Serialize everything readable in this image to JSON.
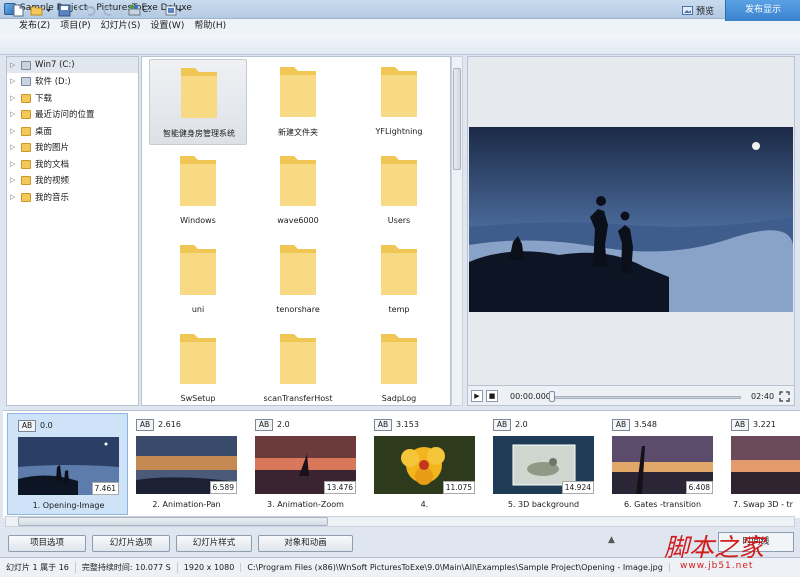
{
  "window": {
    "title": "Sample Project - PicturesToExe Deluxe",
    "controls": {
      "min": "–",
      "max": "□",
      "close": "✕"
    }
  },
  "menu": [
    "发布(Z)",
    "项目(P)",
    "幻灯片(S)",
    "设置(W)",
    "帮助(H)"
  ],
  "toolbar": {
    "drive": "C:",
    "preview": "预览",
    "publish": "发布显示"
  },
  "tree": [
    {
      "label": "Win7 (C:)",
      "icon": "drive-icon",
      "selected": true
    },
    {
      "label": "软件 (D:)",
      "icon": "drive-icon"
    },
    {
      "label": "下载",
      "icon": "folder-icon"
    },
    {
      "label": "最近访问的位置",
      "icon": "folder-icon"
    },
    {
      "label": "桌面",
      "icon": "folder-icon"
    },
    {
      "label": "我的图片",
      "icon": "folder-icon"
    },
    {
      "label": "我的文档",
      "icon": "folder-icon"
    },
    {
      "label": "我的视频",
      "icon": "folder-icon"
    },
    {
      "label": "我的音乐",
      "icon": "folder-icon"
    }
  ],
  "folders": [
    "智能健身房管理系统",
    "新建文件夹",
    "YFLightning",
    "Windows",
    "wave6000",
    "Users",
    "uni",
    "tenorshare",
    "temp",
    "SwSetup",
    "scanTransferHost",
    "SadpLog"
  ],
  "player": {
    "play": "▶",
    "stop": "■",
    "time_start": "00:00.000",
    "time_end": "02:40"
  },
  "slides": [
    {
      "ab": "AB",
      "time": "0.0",
      "duration": "7.461",
      "name": "1. Opening-Image"
    },
    {
      "ab": "AB",
      "time": "2.616",
      "duration": "6.589",
      "name": "2. Animation-Pan"
    },
    {
      "ab": "AB",
      "time": "2.0",
      "duration": "13.476",
      "name": "3. Animation-Zoom"
    },
    {
      "ab": "AB",
      "time": "3.153",
      "duration": "11.075",
      "name": "4."
    },
    {
      "ab": "AB",
      "time": "2.0",
      "duration": "14.924",
      "name": "5. 3D background"
    },
    {
      "ab": "AB",
      "time": "3.548",
      "duration": "6.408",
      "name": "6. Gates -transition"
    },
    {
      "ab": "AB",
      "time": "3.221",
      "duration": "",
      "name": "7. Swap 3D - tr"
    }
  ],
  "bottom_buttons": [
    "项目选项",
    "幻灯片选项",
    "幻灯片样式",
    "对象和动画"
  ],
  "bottom": {
    "up": "▲",
    "ok": "时间线"
  },
  "status": {
    "slide": "幻灯片 1 属于 16",
    "duration": "完整持续时间: 10.077 S",
    "resolution": "1920 x 1080",
    "path": "C:\\Program Files (x86)\\WnSoft PicturesToExe\\9.0\\Main\\All\\Examples\\Sample Project\\Opening - Image.jpg"
  },
  "watermark": {
    "text": "脚本之家",
    "url": "www.jb51.net"
  }
}
